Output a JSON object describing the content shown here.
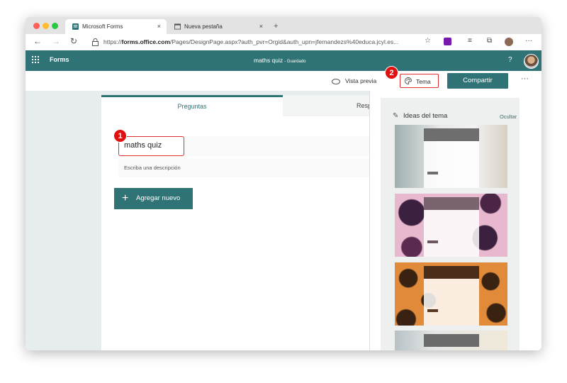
{
  "browser": {
    "tabs": [
      {
        "label": "Microsoft Forms",
        "close": "×",
        "icon": "forms-icon",
        "active": true
      },
      {
        "label": "Nueva pestaña",
        "close": "×",
        "icon": "new-tab-page-icon",
        "active": false
      }
    ],
    "new_tab": "+",
    "url_prefix": "https://",
    "url_host": "forms.office.com",
    "url_path": "/Pages/DesignPage.aspx?auth_pvr=Orgid&auth_upn=jfernandezs%40educa.jcyl.es...",
    "traffic_lights": [
      "#ff5f57",
      "#febc2e",
      "#28c840"
    ]
  },
  "app": {
    "brand": "Forms",
    "doc_title": "maths quiz",
    "doc_status": "- Guardado",
    "help": "?",
    "accent": "#2f7376"
  },
  "toolbar": {
    "preview_label": "Vista previa",
    "theme_label": "Tema",
    "share_label": "Compartir",
    "more_label": "···"
  },
  "editor": {
    "tab_questions": "Preguntas",
    "tab_responses": "Resp",
    "form_title": "maths quiz",
    "description_placeholder": "Escriba una descripción",
    "add_new_label": "Agregar nuevo"
  },
  "theme_panel": {
    "title": "Ideas del tema",
    "hide_label": "Ocultar",
    "themes": [
      {
        "name": "writing-hand-theme",
        "header_color": "#6e6e6e",
        "bar_color": "#6e6e6e"
      },
      {
        "name": "gift-boxes-theme",
        "header_color": "#7a6470",
        "bar_color": "#6e5560"
      },
      {
        "name": "orange-pattern-theme",
        "header_color": "#4a2e1a",
        "bar_color": "#5a3820"
      },
      {
        "name": "grey-desk-theme",
        "header_color": "#6b6b6b",
        "bar_color": "#6b6b6b"
      }
    ]
  },
  "callouts": [
    {
      "number": "1"
    },
    {
      "number": "2"
    }
  ]
}
